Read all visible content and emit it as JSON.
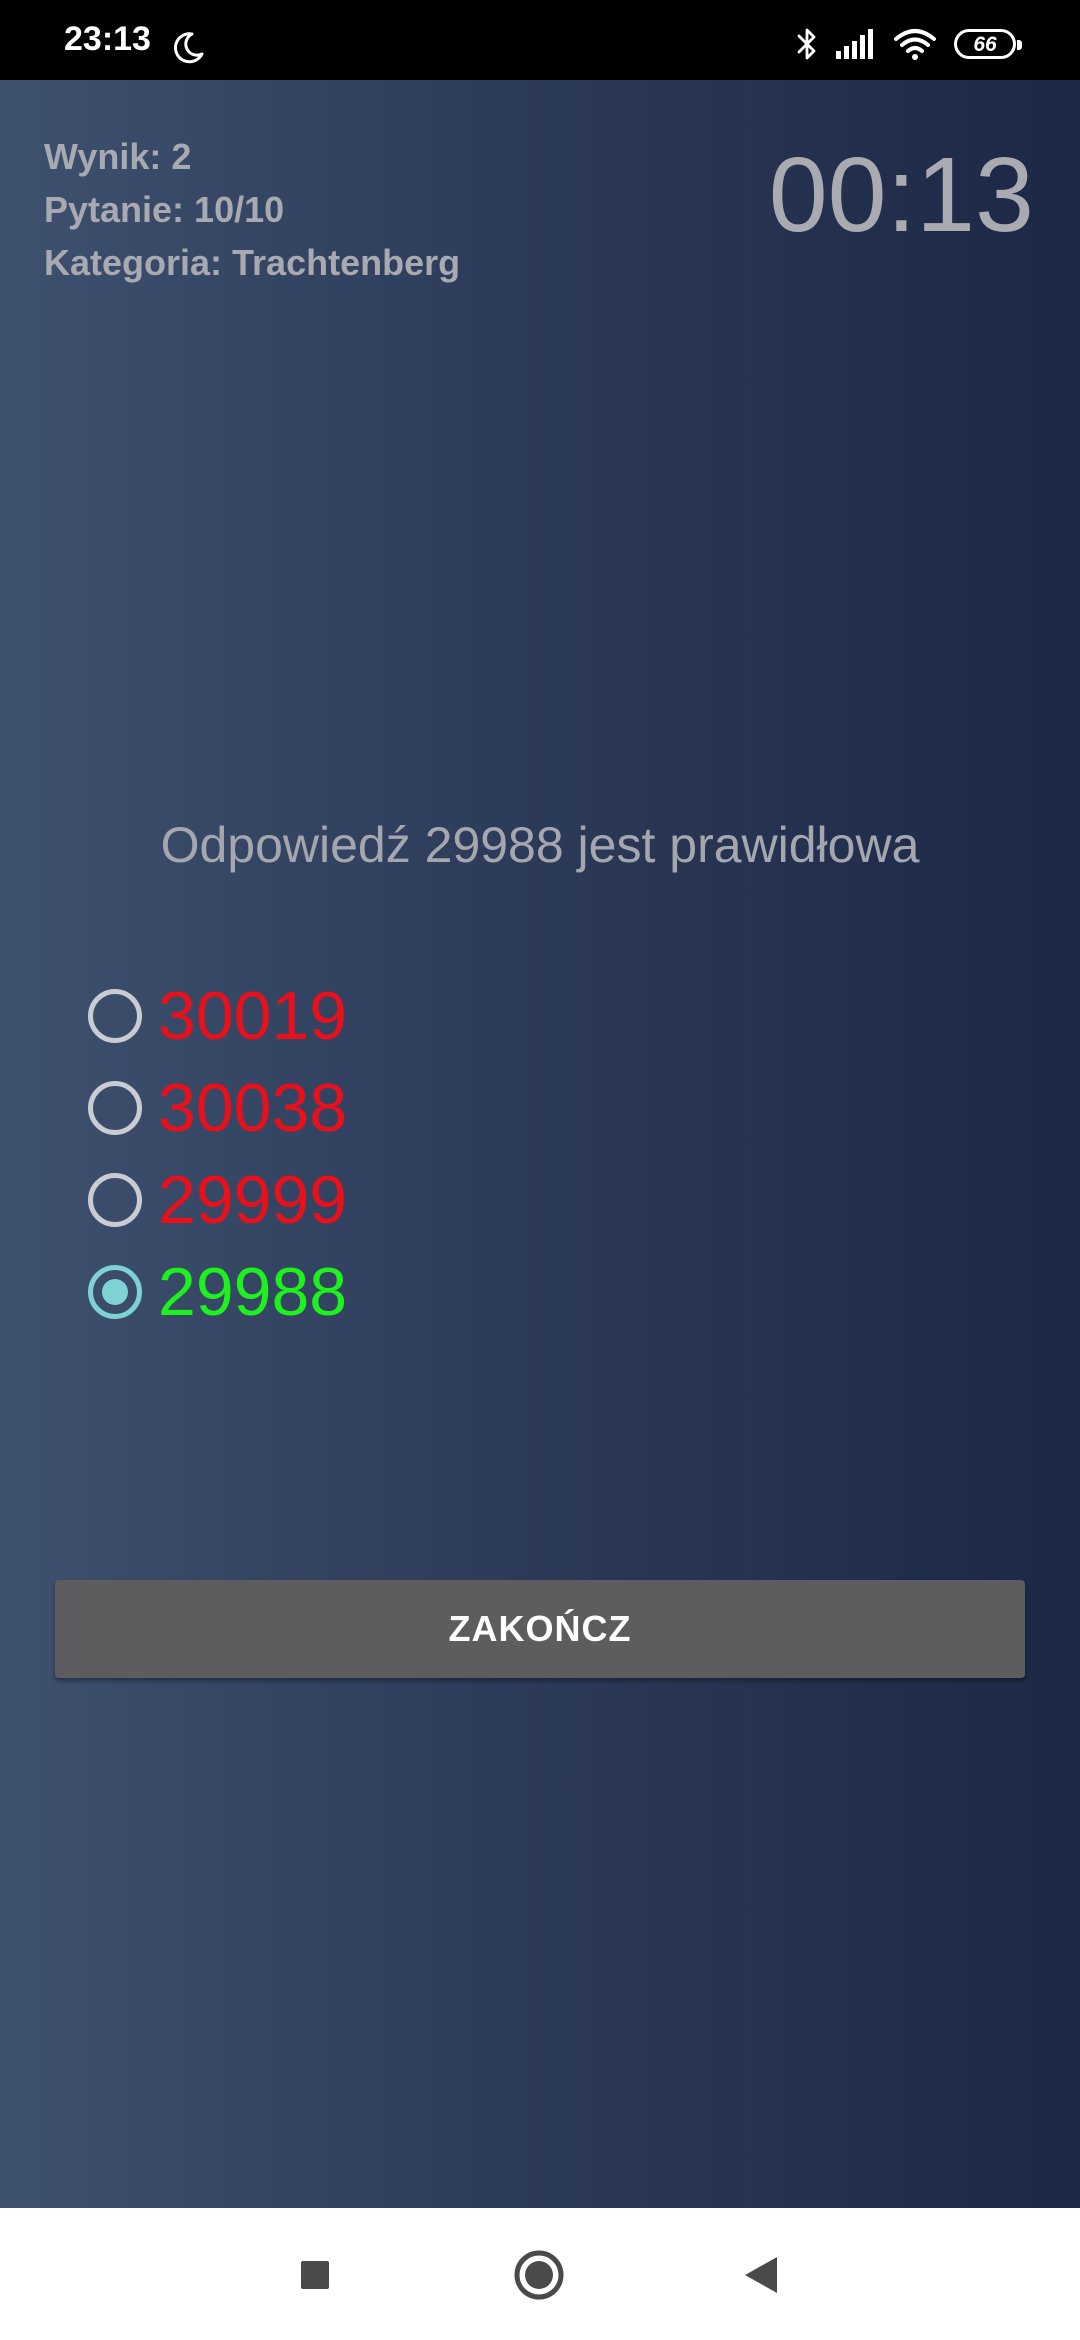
{
  "status_bar": {
    "time": "23:13",
    "icons": [
      "moon-icon",
      "bluetooth-icon",
      "signal-icon",
      "wifi-icon",
      "battery-icon"
    ],
    "battery_level": "66"
  },
  "game": {
    "score": "Wynik: 2",
    "question": "Pytanie: 10/10",
    "category": "Kategoria: Trachtenberg",
    "timer": "00:13",
    "result_message": "Odpowiedź 29988 jest prawidłowa",
    "answers": [
      {
        "value": "30019",
        "selected": false,
        "color": "#e8101b"
      },
      {
        "value": "30038",
        "selected": false,
        "color": "#e8101b"
      },
      {
        "value": "29999",
        "selected": false,
        "color": "#e8101b"
      },
      {
        "value": "29988",
        "selected": true,
        "color": "#1ef21e"
      }
    ],
    "finish_label": "ZAKOŃCZ"
  },
  "nav_bar": {
    "buttons": [
      "recents-icon",
      "home-icon",
      "back-icon"
    ]
  },
  "colors": {
    "background_left": "#3e516e",
    "background_right": "#1c2845",
    "wrong_answer": "#e8101b",
    "correct_answer": "#1ef21e",
    "radio_checked": "#7fd2d3",
    "button": "#5d5d5f"
  }
}
